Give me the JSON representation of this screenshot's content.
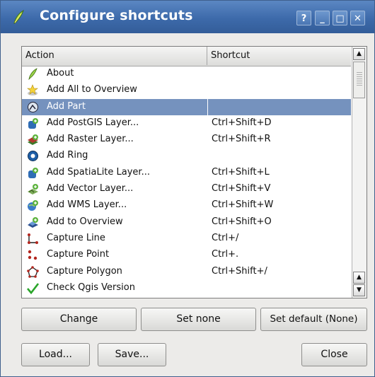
{
  "window": {
    "title": "Configure shortcuts",
    "titlebar_buttons": [
      "?",
      "_",
      "□",
      "✕"
    ]
  },
  "table": {
    "columns": [
      "Action",
      "Shortcut"
    ],
    "rows": [
      {
        "name": "About",
        "shortcut": "",
        "icon": "qgis-logo-icon"
      },
      {
        "name": "Add All to Overview",
        "shortcut": "",
        "icon": "add-all-overview-icon"
      },
      {
        "name": "Add Part",
        "shortcut": "",
        "icon": "add-part-icon",
        "selected": true
      },
      {
        "name": "Add PostGIS Layer...",
        "shortcut": "Ctrl+Shift+D",
        "icon": "add-postgis-layer-icon"
      },
      {
        "name": "Add Raster Layer...",
        "shortcut": "Ctrl+Shift+R",
        "icon": "add-raster-layer-icon"
      },
      {
        "name": "Add Ring",
        "shortcut": "",
        "icon": "add-ring-icon"
      },
      {
        "name": "Add SpatiaLite Layer...",
        "shortcut": "Ctrl+Shift+L",
        "icon": "add-spatialite-layer-icon"
      },
      {
        "name": "Add Vector Layer...",
        "shortcut": "Ctrl+Shift+V",
        "icon": "add-vector-layer-icon"
      },
      {
        "name": "Add WMS Layer...",
        "shortcut": "Ctrl+Shift+W",
        "icon": "add-wms-layer-icon"
      },
      {
        "name": "Add to Overview",
        "shortcut": "Ctrl+Shift+O",
        "icon": "add-to-overview-icon"
      },
      {
        "name": "Capture Line",
        "shortcut": "Ctrl+/",
        "icon": "capture-line-icon"
      },
      {
        "name": "Capture Point",
        "shortcut": "Ctrl+.",
        "icon": "capture-point-icon"
      },
      {
        "name": "Capture Polygon",
        "shortcut": "Ctrl+Shift+/",
        "icon": "capture-polygon-icon"
      },
      {
        "name": "Check Qgis Version",
        "shortcut": "",
        "icon": "check-mark-icon"
      }
    ]
  },
  "buttons": {
    "change": "Change",
    "set_none": "Set none",
    "set_default": "Set default (None)",
    "load": "Load...",
    "save": "Save...",
    "close": "Close"
  },
  "colors": {
    "titlebar": "#3d6aaa",
    "selection": "#7592be"
  }
}
